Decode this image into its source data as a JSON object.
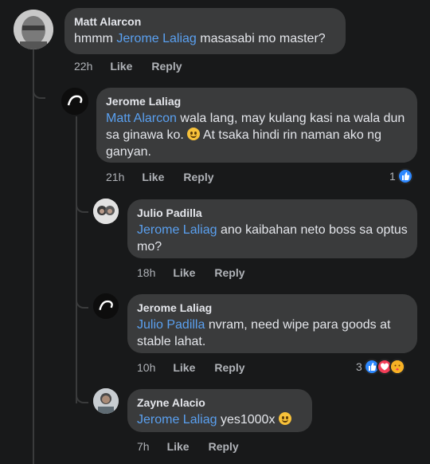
{
  "comments": [
    {
      "author": "Matt Alarcon",
      "text_prefix": "hmmm ",
      "mention": "Jerome Laliag",
      "text_suffix": " masasabi mo master?",
      "time": "22h",
      "like_label": "Like",
      "reply_label": "Reply"
    },
    {
      "author": "Jerome Laliag",
      "mention": "Matt Alarcon",
      "text_part1": " wala lang, may kulang kasi na wala dun sa ginawa ko. ",
      "text_part2": " At tsaka hindi rin naman ako ng ganyan.",
      "time": "21h",
      "like_label": "Like",
      "reply_label": "Reply",
      "reaction_count": "1"
    },
    {
      "author": "Julio Padilla",
      "mention": "Jerome Laliag",
      "text_suffix": " ano kaibahan neto boss sa optus mo?",
      "time": "18h",
      "like_label": "Like",
      "reply_label": "Reply"
    },
    {
      "author": "Jerome Laliag",
      "mention": "Julio Padilla",
      "text_suffix": " nvram, need wipe para goods at stable lahat.",
      "time": "10h",
      "like_label": "Like",
      "reply_label": "Reply",
      "reaction_count": "3"
    },
    {
      "author": "Zayne Alacio",
      "mention": "Jerome Laliag",
      "text_suffix": " yes1000x ",
      "time": "7h",
      "like_label": "Like",
      "reply_label": "Reply"
    }
  ],
  "colors": {
    "background": "#18191a",
    "bubble": "#3a3b3c",
    "mention": "#5aa0f0",
    "muted": "#b0b3b8",
    "like_blue": "#2d88ff",
    "love_red": "#f33e58",
    "care_yellow": "#f7b125"
  },
  "icons": [
    "like-reaction-icon",
    "love-reaction-icon",
    "care-reaction-icon",
    "smile-emoji-icon"
  ]
}
